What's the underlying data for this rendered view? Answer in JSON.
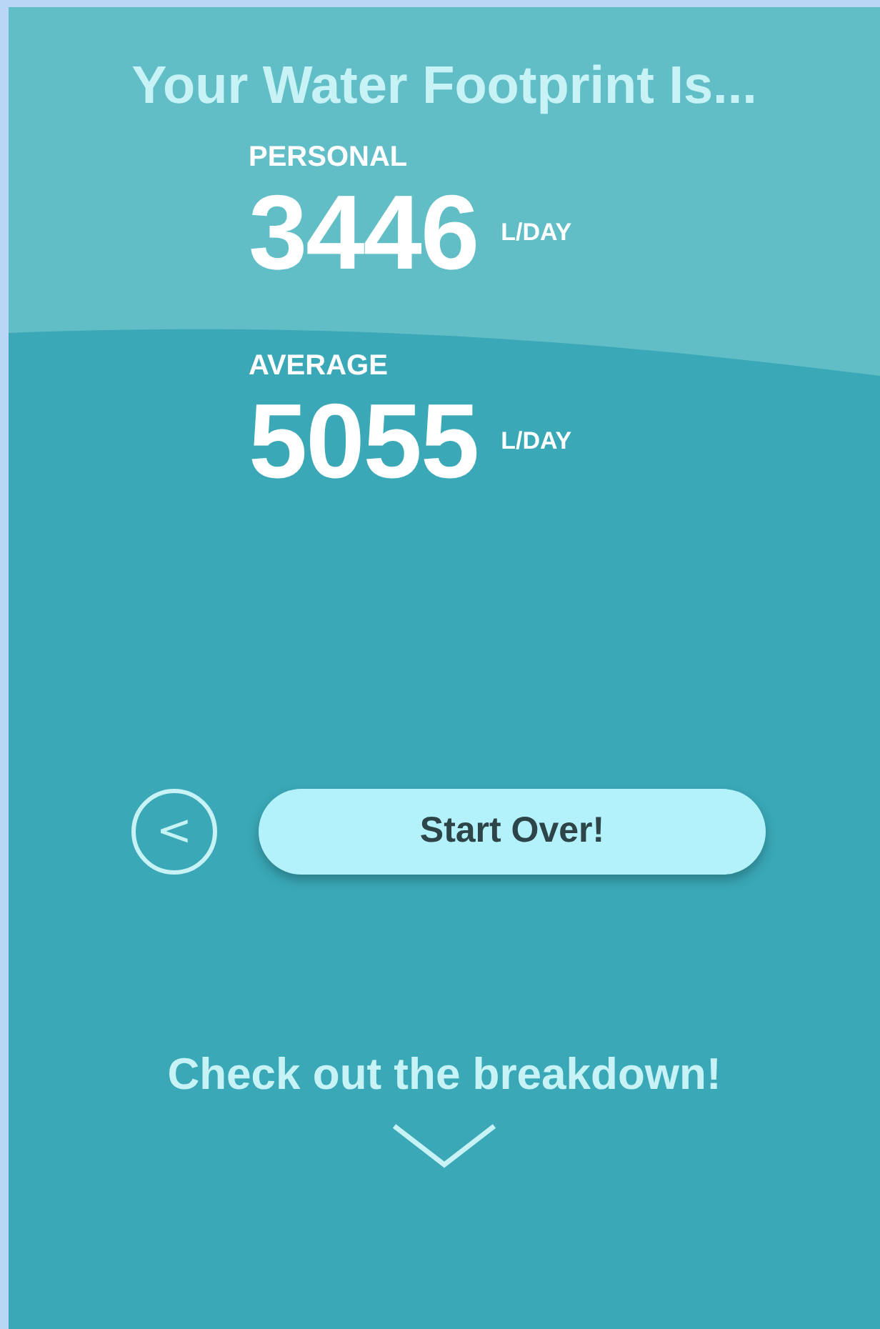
{
  "title": "Your Water Footprint Is...",
  "stats": [
    {
      "label": "PERSONAL",
      "value": "3446",
      "unit": "L/DAY"
    },
    {
      "label": "AVERAGE",
      "value": "5055",
      "unit": "L/DAY"
    }
  ],
  "back_button": {
    "icon": "<"
  },
  "start_button": {
    "label": "Start Over!"
  },
  "breakdown": {
    "label": "Check out the breakdown!"
  }
}
